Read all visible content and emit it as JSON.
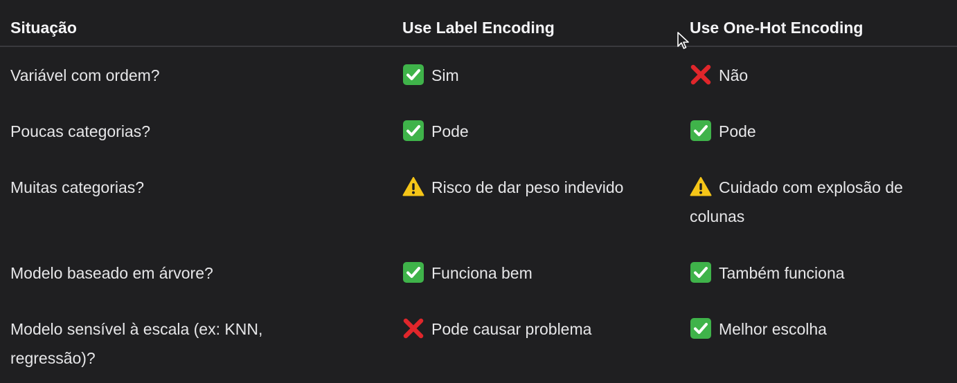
{
  "table": {
    "headers": [
      "Situação",
      "Use Label Encoding",
      "Use One-Hot Encoding"
    ],
    "rows": [
      {
        "situation": "Variável com ordem?",
        "label_icon": "check-mark-icon",
        "label_text": "Sim",
        "onehot_icon": "cross-mark-icon",
        "onehot_text": "Não"
      },
      {
        "situation": "Poucas categorias?",
        "label_icon": "check-mark-icon",
        "label_text": "Pode",
        "onehot_icon": "check-mark-icon",
        "onehot_text": "Pode"
      },
      {
        "situation": "Muitas categorias?",
        "label_icon": "warning-icon",
        "label_text": "Risco de dar peso indevido",
        "onehot_icon": "warning-icon",
        "onehot_text": "Cuidado com explosão de colunas"
      },
      {
        "situation": "Modelo baseado em árvore?",
        "label_icon": "check-mark-icon",
        "label_text": "Funciona bem",
        "onehot_icon": "check-mark-icon",
        "onehot_text": "Também funciona"
      },
      {
        "situation": "Modelo sensível à escala (ex: KNN, regressão)?",
        "label_icon": "cross-mark-icon",
        "label_text": "Pode causar problema",
        "onehot_icon": "check-mark-icon",
        "onehot_text": "Melhor escolha"
      }
    ]
  },
  "colors": {
    "background": "#1f1f21",
    "text": "#e6e6e8",
    "check": "#3fb34a",
    "cross": "#e0262b",
    "warning": "#f5c518"
  }
}
